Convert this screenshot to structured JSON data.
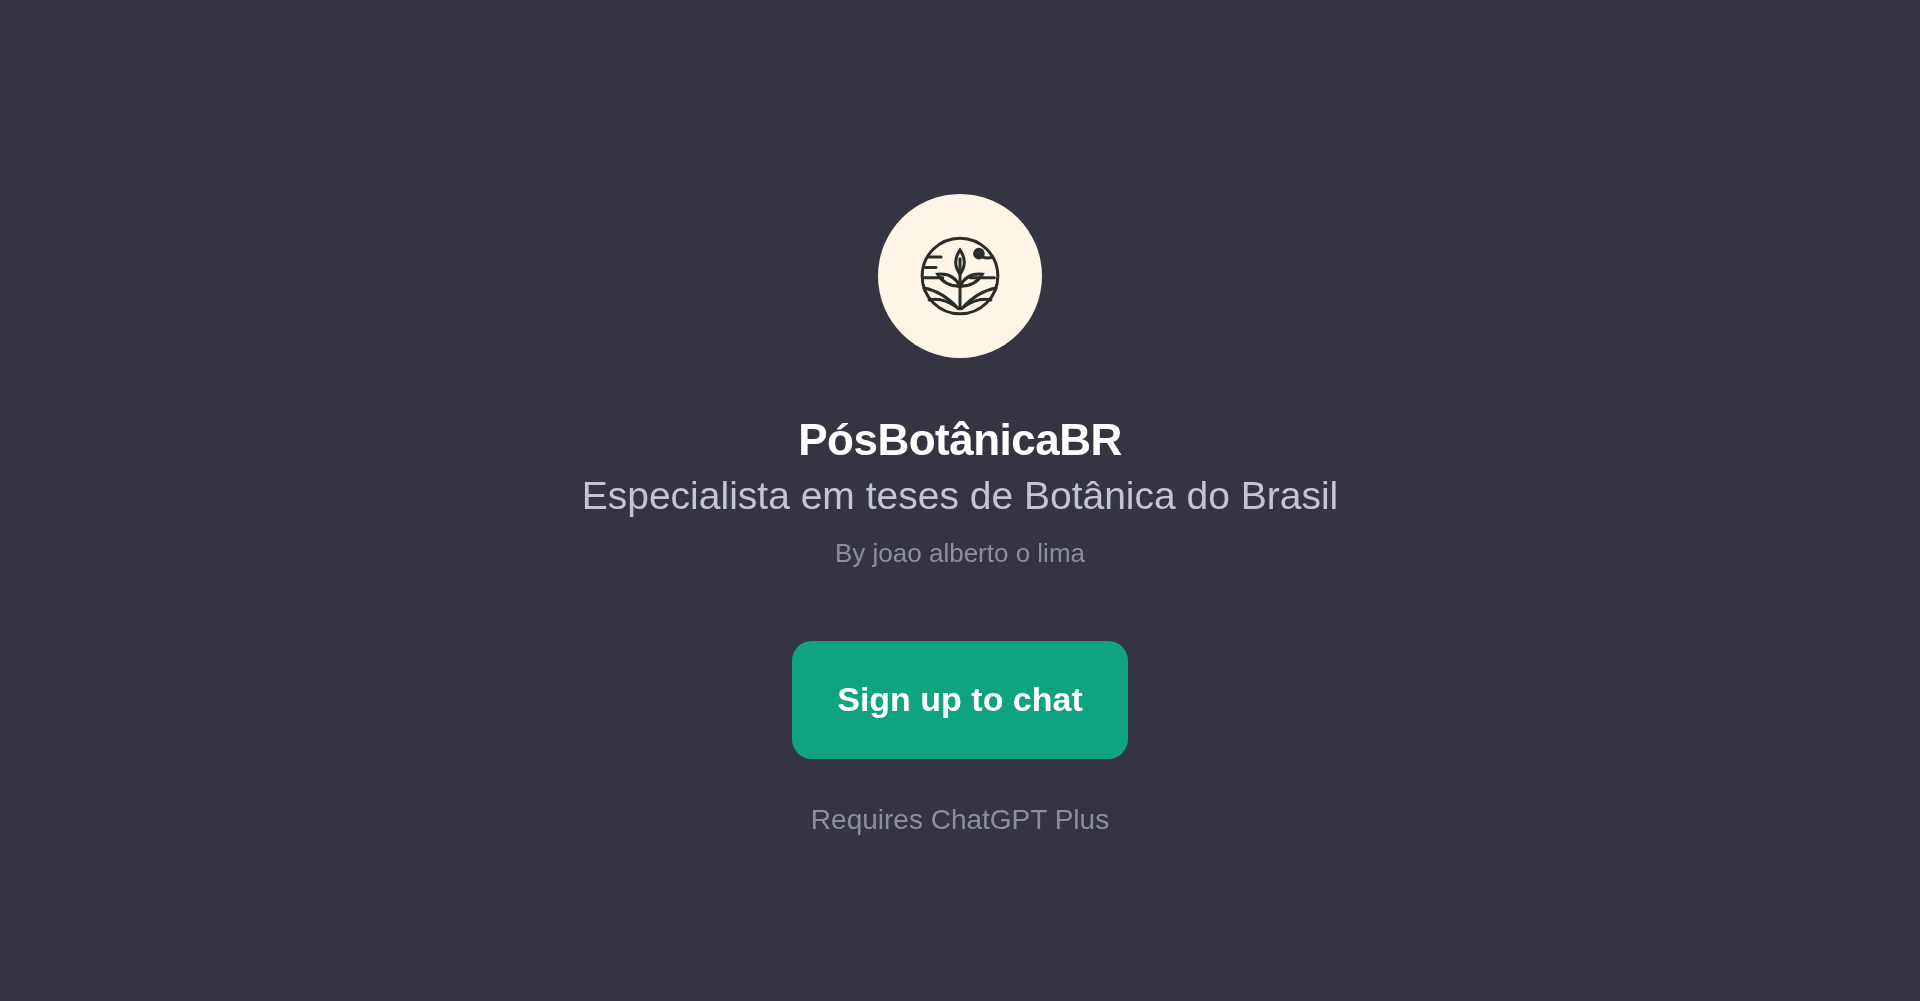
{
  "title": "PósBotânicaBR",
  "description": "Especialista em teses de Botânica do Brasil",
  "author": "By joao alberto o lima",
  "button": "Sign up to chat",
  "note": "Requires ChatGPT Plus"
}
